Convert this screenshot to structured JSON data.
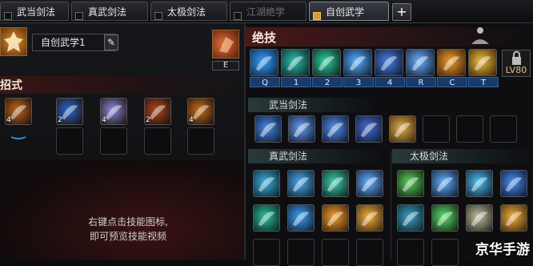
{
  "tabs": [
    {
      "label": "武当剑法",
      "state": "normal"
    },
    {
      "label": "真武剑法",
      "state": "normal"
    },
    {
      "label": "太极剑法",
      "state": "normal"
    },
    {
      "label": "江湖绝学",
      "state": "disabled"
    },
    {
      "label": "自创武学",
      "state": "active"
    }
  ],
  "add_tab_label": "+",
  "left": {
    "name_value": "自创武学1",
    "edit_icon": "pencil-icon",
    "key_label": "E",
    "section_title": "招式",
    "combo_slots": [
      {
        "count": "4",
        "color": "#c06a20"
      },
      {
        "count": "2",
        "color": "#2a6ad0"
      },
      {
        "count": "4",
        "color": "#8a8ae0"
      },
      {
        "count": "2",
        "color": "#b04a20"
      },
      {
        "count": "4",
        "color": "#c8701c"
      }
    ],
    "hint_line1": "右键点击技能图标,",
    "hint_line2": "即可预览技能视频"
  },
  "right": {
    "title": "绝技",
    "hotkeys": [
      "Q",
      "1",
      "2",
      "3",
      "4",
      "R",
      "C",
      "T"
    ],
    "lock_level": "LV80",
    "sections": {
      "wudang": "武当剑法",
      "zhenwu": "真武剑法",
      "taiji": "太极剑法"
    }
  },
  "brand": "京华手游"
}
